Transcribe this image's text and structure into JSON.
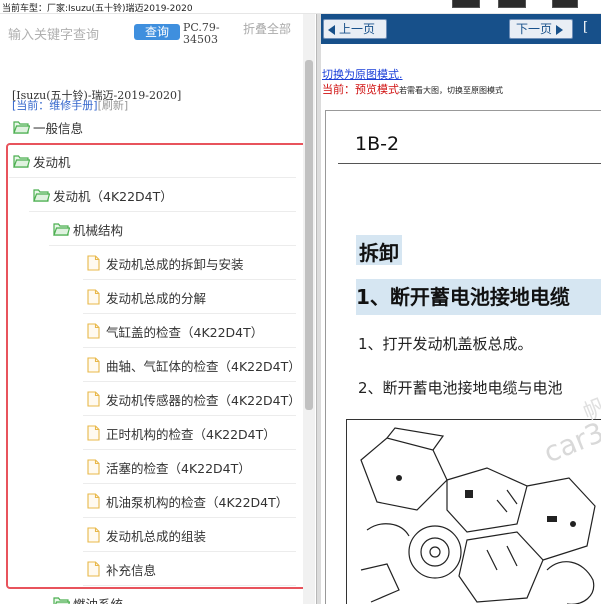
{
  "topbar": {
    "car_info": "当前车型：厂家:Isuzu(五十铃)瑞迈2019-2020"
  },
  "search": {
    "placeholder": "输入关键字查询"
  },
  "toolbar": {
    "query_label": "查询",
    "pc_code": "PC.79-34503",
    "collapse_all": "折叠全部"
  },
  "manual": {
    "title": "[Isuzu(五十铃)-瑞迈-2019-2020]",
    "current": "[当前：维修手册]",
    "refresh": "[刷新]"
  },
  "tree": [
    {
      "label": "一般信息",
      "icon": "folder-open-icon",
      "level": 0
    },
    {
      "label": "发动机",
      "icon": "folder-open-icon",
      "level": 0
    },
    {
      "label": "发动机（4K22D4T）",
      "icon": "folder-open-icon",
      "level": 1
    },
    {
      "label": "机械结构",
      "icon": "folder-open-icon",
      "level": 2
    },
    {
      "label": "发动机总成的拆卸与安装",
      "icon": "document-icon",
      "level": 3
    },
    {
      "label": "发动机总成的分解",
      "icon": "document-icon",
      "level": 3
    },
    {
      "label": "气缸盖的检查（4K22D4T）",
      "icon": "document-icon",
      "level": 3
    },
    {
      "label": "曲轴、气缸体的检查（4K22D4T）",
      "icon": "document-icon",
      "level": 3
    },
    {
      "label": "发动机传感器的检查（4K22D4T）",
      "icon": "document-icon",
      "level": 3
    },
    {
      "label": "正时机构的检查（4K22D4T）",
      "icon": "document-icon",
      "level": 3
    },
    {
      "label": "活塞的检查（4K22D4T）",
      "icon": "document-icon",
      "level": 3
    },
    {
      "label": "机油泵机构的检查（4K22D4T）",
      "icon": "document-icon",
      "level": 3
    },
    {
      "label": "发动机总成的组装",
      "icon": "document-icon",
      "level": 3
    },
    {
      "label": "补充信息",
      "icon": "document-icon",
      "level": 3
    },
    {
      "label": "燃油系统",
      "icon": "folder-open-icon",
      "level": 2
    }
  ],
  "viewer": {
    "prev_label": "上一页",
    "next_label": "下一页",
    "extra": "[",
    "switch_link": "切换为原图模式.",
    "preview_label": "当前：预览模式",
    "preview_hint": "若需看大图，切换至原图模式"
  },
  "doc": {
    "page_number": "1B-2",
    "section": "拆卸",
    "step_heading": "1、断开蓄电池接地电缆",
    "steps": [
      "1、打开发动机盖板总成。",
      "2、断开蓄电池接地电缆与电池"
    ],
    "watermark": "car3"
  },
  "colors": {
    "accent": "#3f8fde",
    "nav_bar": "#17508a",
    "frame": "#e8535c",
    "folder": "#4caf50",
    "document": "#e8b84a"
  }
}
